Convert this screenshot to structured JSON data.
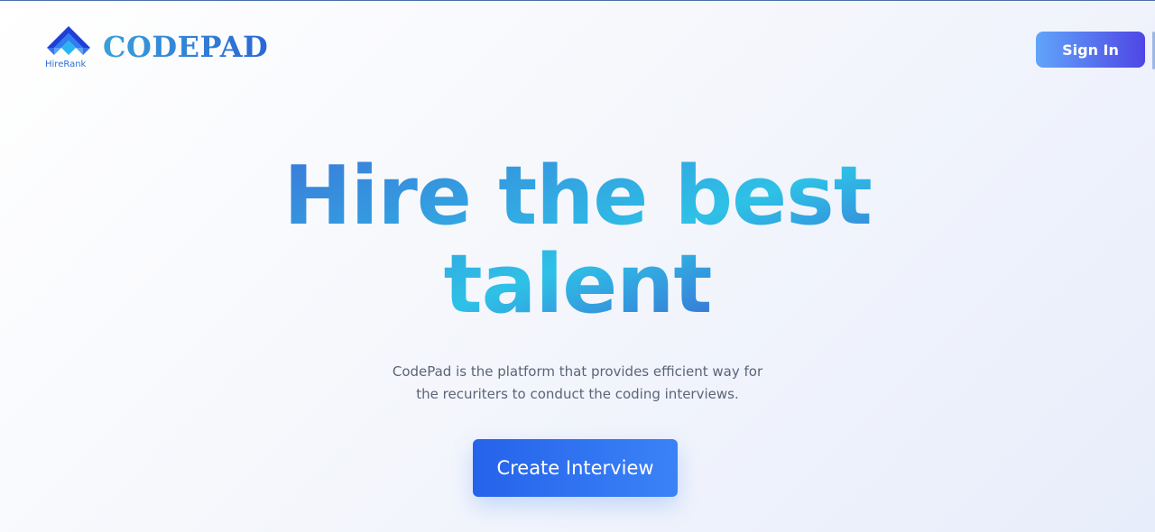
{
  "brand": {
    "logo_caption": "HireRank",
    "name": "CODEPAD",
    "logo_icon": "hirerank-logo-icon"
  },
  "nav": {
    "signin_label": "Sign In"
  },
  "hero": {
    "title_line1": "Hire the best",
    "title_line2": "talent",
    "subtitle_line1": "CodePad is the platform that provides efficient way for",
    "subtitle_line2": "the recuriters to conduct the coding interviews.",
    "cta_label": "Create Interview"
  },
  "colors": {
    "accent_blue": "#2563eb",
    "accent_indigo": "#4f46e5",
    "accent_cyan": "#2ec1e6",
    "subtitle_gray": "#5b6478"
  }
}
